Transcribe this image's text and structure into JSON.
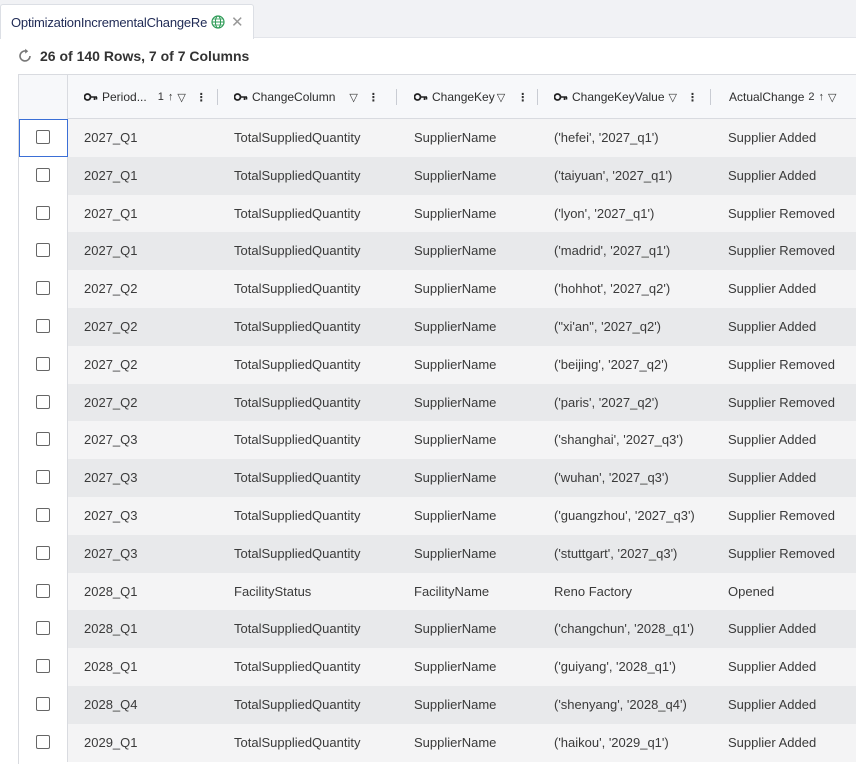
{
  "tab": {
    "title": "OptimizationIncrementalChangeRe",
    "close": "✕"
  },
  "status": {
    "text": "26 of 140 Rows, 7 of 7 Columns"
  },
  "columns": [
    {
      "label": "Period...",
      "sort_order": "1",
      "key": true
    },
    {
      "label": "ChangeColumn",
      "key": true
    },
    {
      "label": "ChangeKey",
      "key": true
    },
    {
      "label": "ChangeKeyValue",
      "key": true
    },
    {
      "label": "ActualChange",
      "sort_order": "2",
      "key": false
    }
  ],
  "rows": [
    [
      "2027_Q1",
      "TotalSuppliedQuantity",
      "SupplierName",
      "('hefei', '2027_q1')",
      "Supplier Added"
    ],
    [
      "2027_Q1",
      "TotalSuppliedQuantity",
      "SupplierName",
      "('taiyuan', '2027_q1')",
      "Supplier Added"
    ],
    [
      "2027_Q1",
      "TotalSuppliedQuantity",
      "SupplierName",
      "('lyon', '2027_q1')",
      "Supplier Removed"
    ],
    [
      "2027_Q1",
      "TotalSuppliedQuantity",
      "SupplierName",
      "('madrid', '2027_q1')",
      "Supplier Removed"
    ],
    [
      "2027_Q2",
      "TotalSuppliedQuantity",
      "SupplierName",
      "('hohhot', '2027_q2')",
      "Supplier Added"
    ],
    [
      "2027_Q2",
      "TotalSuppliedQuantity",
      "SupplierName",
      "(\"xi'an\", '2027_q2')",
      "Supplier Added"
    ],
    [
      "2027_Q2",
      "TotalSuppliedQuantity",
      "SupplierName",
      "('beijing', '2027_q2')",
      "Supplier Removed"
    ],
    [
      "2027_Q2",
      "TotalSuppliedQuantity",
      "SupplierName",
      "('paris', '2027_q2')",
      "Supplier Removed"
    ],
    [
      "2027_Q3",
      "TotalSuppliedQuantity",
      "SupplierName",
      "('shanghai', '2027_q3')",
      "Supplier Added"
    ],
    [
      "2027_Q3",
      "TotalSuppliedQuantity",
      "SupplierName",
      "('wuhan', '2027_q3')",
      "Supplier Added"
    ],
    [
      "2027_Q3",
      "TotalSuppliedQuantity",
      "SupplierName",
      "('guangzhou', '2027_q3')",
      "Supplier Removed"
    ],
    [
      "2027_Q3",
      "TotalSuppliedQuantity",
      "SupplierName",
      "('stuttgart', '2027_q3')",
      "Supplier Removed"
    ],
    [
      "2028_Q1",
      "FacilityStatus",
      "FacilityName",
      "Reno Factory",
      "Opened"
    ],
    [
      "2028_Q1",
      "TotalSuppliedQuantity",
      "SupplierName",
      "('changchun', '2028_q1')",
      "Supplier Added"
    ],
    [
      "2028_Q1",
      "TotalSuppliedQuantity",
      "SupplierName",
      "('guiyang', '2028_q1')",
      "Supplier Added"
    ],
    [
      "2028_Q4",
      "TotalSuppliedQuantity",
      "SupplierName",
      "('shenyang', '2028_q4')",
      "Supplier Added"
    ],
    [
      "2029_Q1",
      "TotalSuppliedQuantity",
      "SupplierName",
      "('haikou', '2029_q1')",
      "Supplier Added"
    ]
  ]
}
